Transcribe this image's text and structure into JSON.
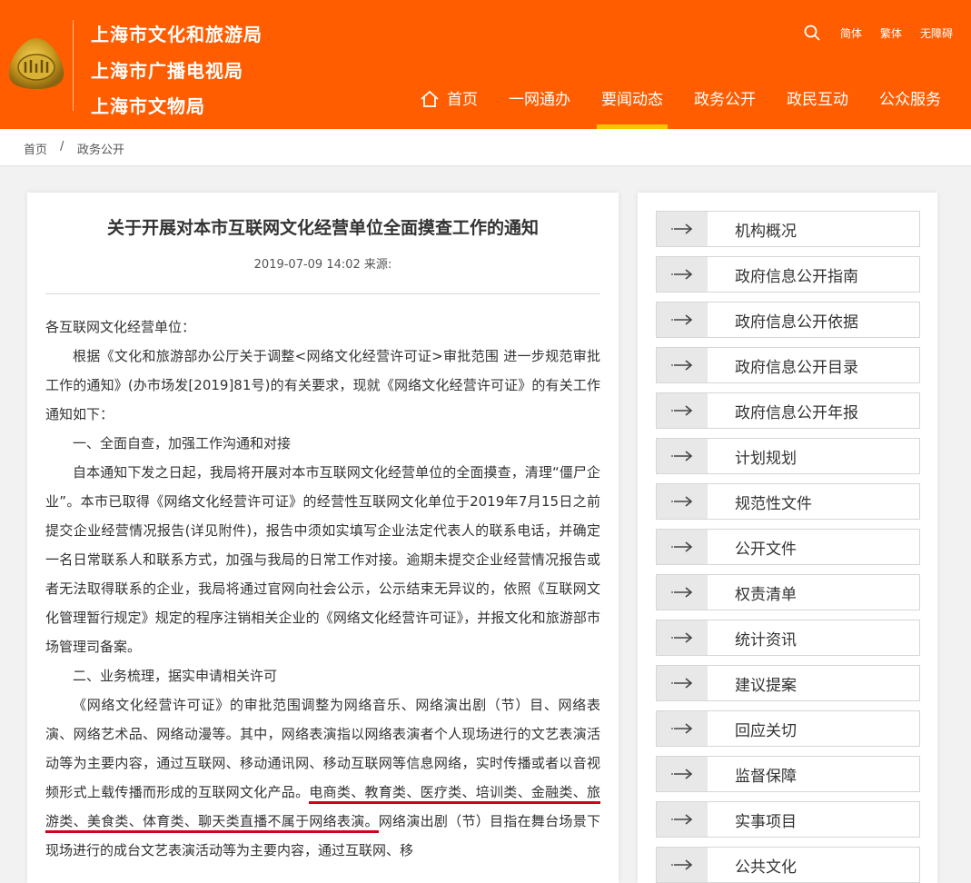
{
  "header": {
    "org_names": [
      "上海市文化和旅游局",
      "上海市广播电视局",
      "上海市文物局"
    ],
    "tools": [
      "简体",
      "繁体",
      "无障碍"
    ],
    "nav": [
      "首页",
      "一网通办",
      "要闻动态",
      "政务公开",
      "政民互动",
      "公众服务"
    ],
    "active_nav": "要闻动态",
    "brand_color": "#ff5d00",
    "active_underline_color": "#f6c700"
  },
  "breadcrumb": {
    "home": "首页",
    "separator": "/",
    "current": "政务公开"
  },
  "article": {
    "title": "关于开展对本市互联网文化经营单位全面摸查工作的通知",
    "meta": "2019-07-09 14:02 来源:",
    "greeting": "各互联网文化经营单位：",
    "p1": "根据《文化和旅游部办公厅关于调整<网络文化经营许可证>审批范围 进一步规范审批工作的通知》(办市场发[2019]81号)的有关要求，现就《网络文化经营许可证》的有关工作通知如下：",
    "h1": "一、全面自查，加强工作沟通和对接",
    "p2": "自本通知下发之日起，我局将开展对本市互联网文化经营单位的全面摸查，清理“僵尸企业”。本市已取得《网络文化经营许可证》的经营性互联网文化单位于2019年7月15日之前提交企业经营情况报告(详见附件)，报告中须如实填写企业法定代表人的联系电话，并确定一名日常联系人和联系方式，加强与我局的日常工作对接。逾期未提交企业经营情况报告或者无法取得联系的企业，我局将通过官网向社会公示，公示结束无异议的，依照《互联网文化管理暂行规定》规定的程序注销相关企业的《网络文化经营许可证》，并报文化和旅游部市场管理司备案。",
    "h2": "二、业务梳理，据实申请相关许可",
    "p3_a": "《网络文化经营许可证》的审批范围调整为网络音乐、网络演出剧（节）目、网络表演、网络艺术品、网络动漫等。其中，网络表演指以网络表演者个人现场进行的文艺表演活动等为主要内容，通过互联网、移动通讯网、移动互联网等信息网络，实时传播或者以音视频形式上载传播而形成的互联网文化产品。",
    "p3_highlight": "电商类、教育类、医疗类、培训类、金融类、旅游类、美食类、体育类、聊天类直播不属于网络表演。",
    "p3_b": "网络演出剧（节）目指在舞台场景下现场进行的成台文艺表演活动等为主要内容，通过互联网、移"
  },
  "sidebar": {
    "items": [
      "机构概况",
      "政府信息公开指南",
      "政府信息公开依据",
      "政府信息公开目录",
      "政府信息公开年报",
      "计划规划",
      "规范性文件",
      "公开文件",
      "权责清单",
      "统计资讯",
      "建议提案",
      "回应关切",
      "监督保障",
      "实事项目",
      "公共文化"
    ]
  }
}
